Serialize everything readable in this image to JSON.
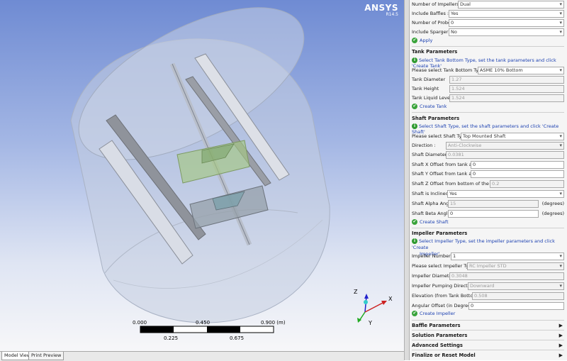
{
  "brand": {
    "name": "ANSYS",
    "version": "R14.5"
  },
  "scale": {
    "top_ticks": [
      "0.000",
      "0.450",
      "0.900 (m)"
    ],
    "bottom_ticks": [
      "0.225",
      "0.675"
    ]
  },
  "axes": {
    "x": "X",
    "y": "Y",
    "z": "Z"
  },
  "tabs": [
    {
      "label": "Model View",
      "active": true
    },
    {
      "label": "Print Preview",
      "active": false
    }
  ],
  "colors": {
    "viewport_top": "#6f8bd3",
    "viewport_bottom": "#f7f7f9",
    "link": "#1a3fb0",
    "ok_green": "#39a33a"
  },
  "panel": {
    "general": {
      "num_impellers": {
        "label": "Number of Impellers :",
        "value": "Dual"
      },
      "include_baffles": {
        "label": "Include Baffles :",
        "value": "Yes"
      },
      "num_probes": {
        "label": "Number of Probes :",
        "value": "0"
      },
      "include_sparger": {
        "label": "Include Sparger :",
        "value": "No"
      },
      "apply": "Apply"
    },
    "tank": {
      "header": "Tank Parameters",
      "info": "Select Tank Bottom Type, set the tank parameters and click 'Create Tank'",
      "bottom_type": {
        "label": "Please select Tank Bottom Type",
        "value": "ASME 10% Bottom"
      },
      "diameter": {
        "label": "Tank Diameter",
        "value": "1.27"
      },
      "height": {
        "label": "Tank Height",
        "value": "1.524"
      },
      "liquid_level": {
        "label": "Tank Liquid Level",
        "value": "1.524"
      },
      "create": "Create Tank"
    },
    "shaft": {
      "header": "Shaft Parameters",
      "info": "Select Shaft Type, set the shaft parameters and click 'Create Shaft'",
      "type": {
        "label": "Please select Shaft Type",
        "value": "Top Mounted Shaft"
      },
      "direction": {
        "label": "Direction :",
        "value": "Anti-Clockwise"
      },
      "diameter": {
        "label": "Shaft Diameter",
        "value": "0.0381"
      },
      "x_offset": {
        "label": "Shaft X Offset from tank axis",
        "value": "0"
      },
      "y_offset": {
        "label": "Shaft Y Offset from tank axis",
        "value": "0"
      },
      "z_offset": {
        "label": "Shaft Z Offset from bottom of the tank",
        "value": "0.2"
      },
      "inclined": {
        "label": "Shaft is Inclined",
        "value": "Yes"
      },
      "alpha": {
        "label": "Shaft Alpha Angle",
        "value": "15",
        "unit": "(degrees)"
      },
      "beta": {
        "label": "Shaft Beta Angle",
        "value": "0",
        "unit": "(degrees)"
      },
      "create": "Create Shaft"
    },
    "impeller": {
      "header": "Impeller Parameters",
      "info_line1": "Select Impeller Type, set the impeller parameters and click 'Create",
      "info_line2": "Impeller'",
      "number": {
        "label": "Impeller Number :",
        "value": "1"
      },
      "type": {
        "label": "Please select Impeller Type",
        "value": "RC Impeller STD"
      },
      "diameter": {
        "label": "Impeller Diameter",
        "value": "0.3048"
      },
      "pumping": {
        "label": "Impeller Pumping Direction",
        "value": "Downward"
      },
      "elevation": {
        "label": "Elevation (from Tank Bottom)",
        "value": "0.508"
      },
      "angular": {
        "label": "Angular Offset (in Degrees)",
        "value": "0"
      },
      "create": "Create Impeller"
    },
    "sections": [
      "Baffle Parameters",
      "Solution Parameters",
      "Advanced Settings",
      "Finalize or Reset Model"
    ]
  }
}
